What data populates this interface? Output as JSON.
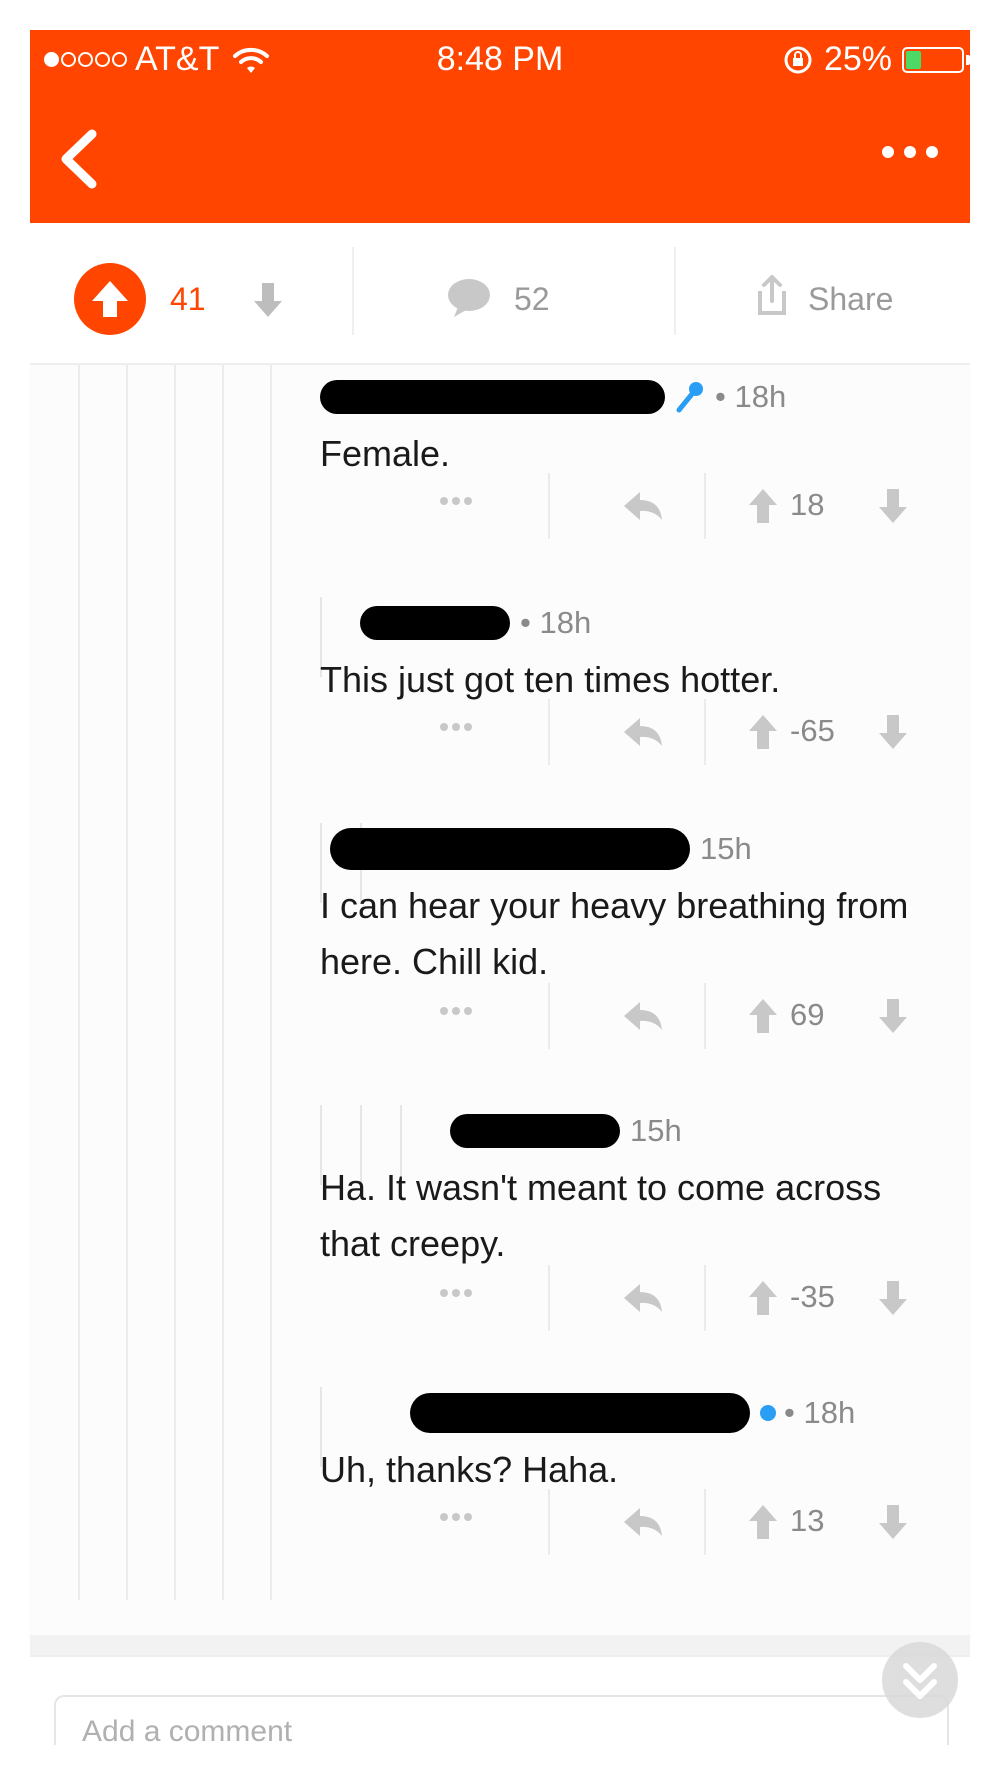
{
  "status_bar": {
    "carrier": "AT&T",
    "signal_dots_filled": 1,
    "time": "8:48 PM",
    "battery_percent": "25%",
    "battery_level": 0.25
  },
  "colors": {
    "brand": "#ff4500",
    "upvote": "#ff4500",
    "muted": "#8a8a8a",
    "text": "#1a1a1b",
    "op_icon": "#2a9df4"
  },
  "nav": {
    "back_icon": "chevron-left-icon",
    "more_icon": "ellipsis-icon"
  },
  "post_actions": {
    "score": "41",
    "comment_count": "52",
    "share_label": "Share"
  },
  "comments": [
    {
      "time": "• 18h",
      "body": "Female.",
      "score": "18",
      "has_mic_icon": true
    },
    {
      "time": "• 18h",
      "body": "This just got ten times hotter.",
      "score": "-65",
      "has_mic_icon": false
    },
    {
      "time": "15h",
      "body": "I can hear your heavy breathing from here. Chill kid.",
      "score": "69",
      "has_mic_icon": false
    },
    {
      "time": "15h",
      "body": "Ha. It wasn't meant to come across that creepy.",
      "score": "-35",
      "has_mic_icon": false
    },
    {
      "time": "• 18h",
      "body": "Uh, thanks? Haha.",
      "score": "13",
      "has_mic_icon": false
    }
  ],
  "footer": {
    "add_comment_placeholder": "Add a comment"
  }
}
